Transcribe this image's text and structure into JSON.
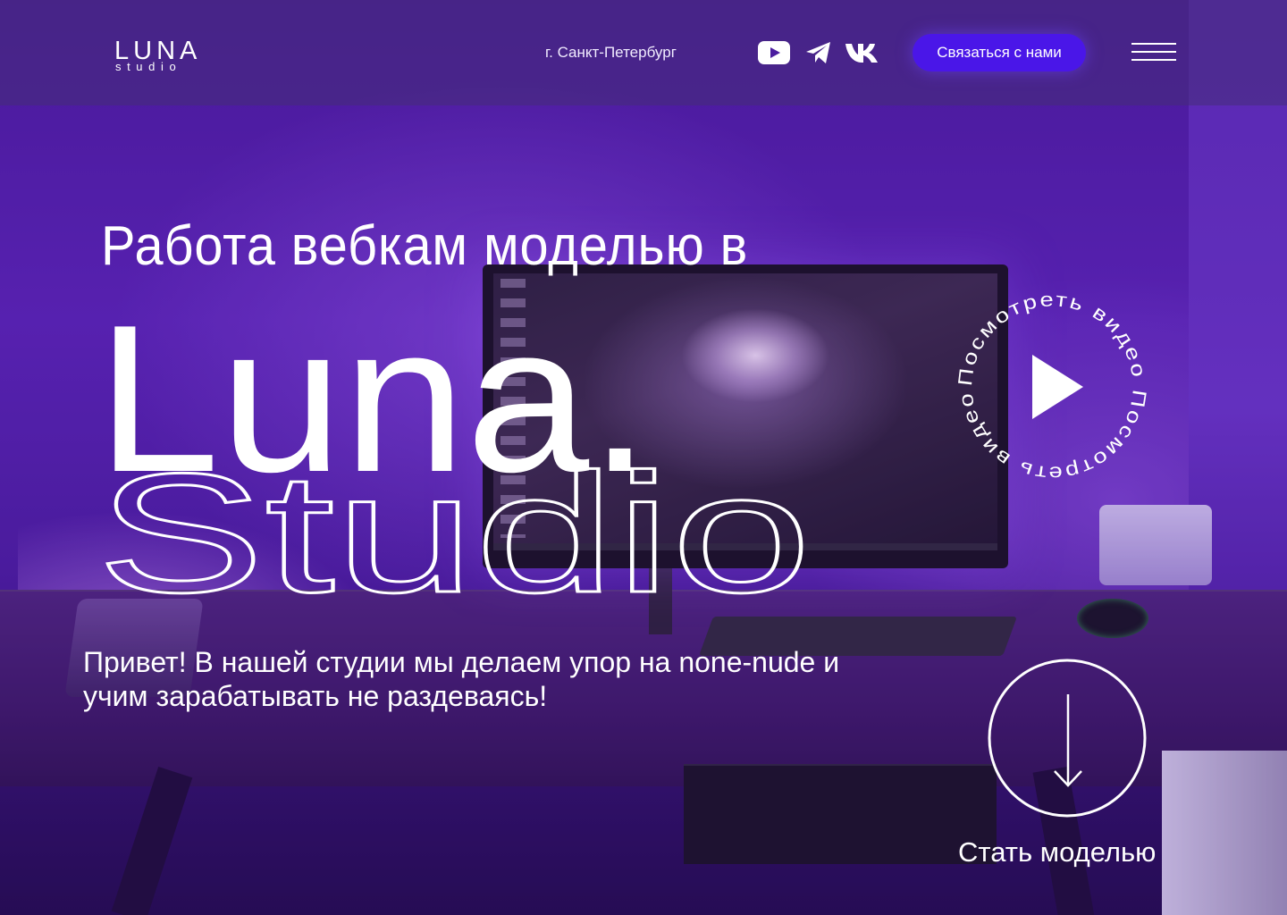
{
  "header": {
    "logo": {
      "main": "LUNA",
      "sub": "studio"
    },
    "city": "г. Санкт-Петербург",
    "social": [
      {
        "name": "youtube",
        "icon": "youtube-icon"
      },
      {
        "name": "telegram",
        "icon": "telegram-icon"
      },
      {
        "name": "vk",
        "icon": "vk-icon"
      }
    ],
    "contact_button": "Связаться с нами",
    "menu_icon": "hamburger-menu-icon"
  },
  "hero": {
    "subtitle": "Работа вебкам моделью в",
    "title_line1": "Luna.",
    "title_line2": "Studio",
    "description": "Привет! В нашей студии мы делаем упор на none-nude и учим зарабатывать не раздеваясь!"
  },
  "video": {
    "circle_text": "Посмотреть видео Посмотреть видео",
    "icon": "play-icon"
  },
  "cta": {
    "label": "Стать моделью",
    "icon": "arrow-down-icon"
  },
  "colors": {
    "accent": "#4a16e8",
    "background": "#4a1a9c",
    "text": "#ffffff"
  }
}
